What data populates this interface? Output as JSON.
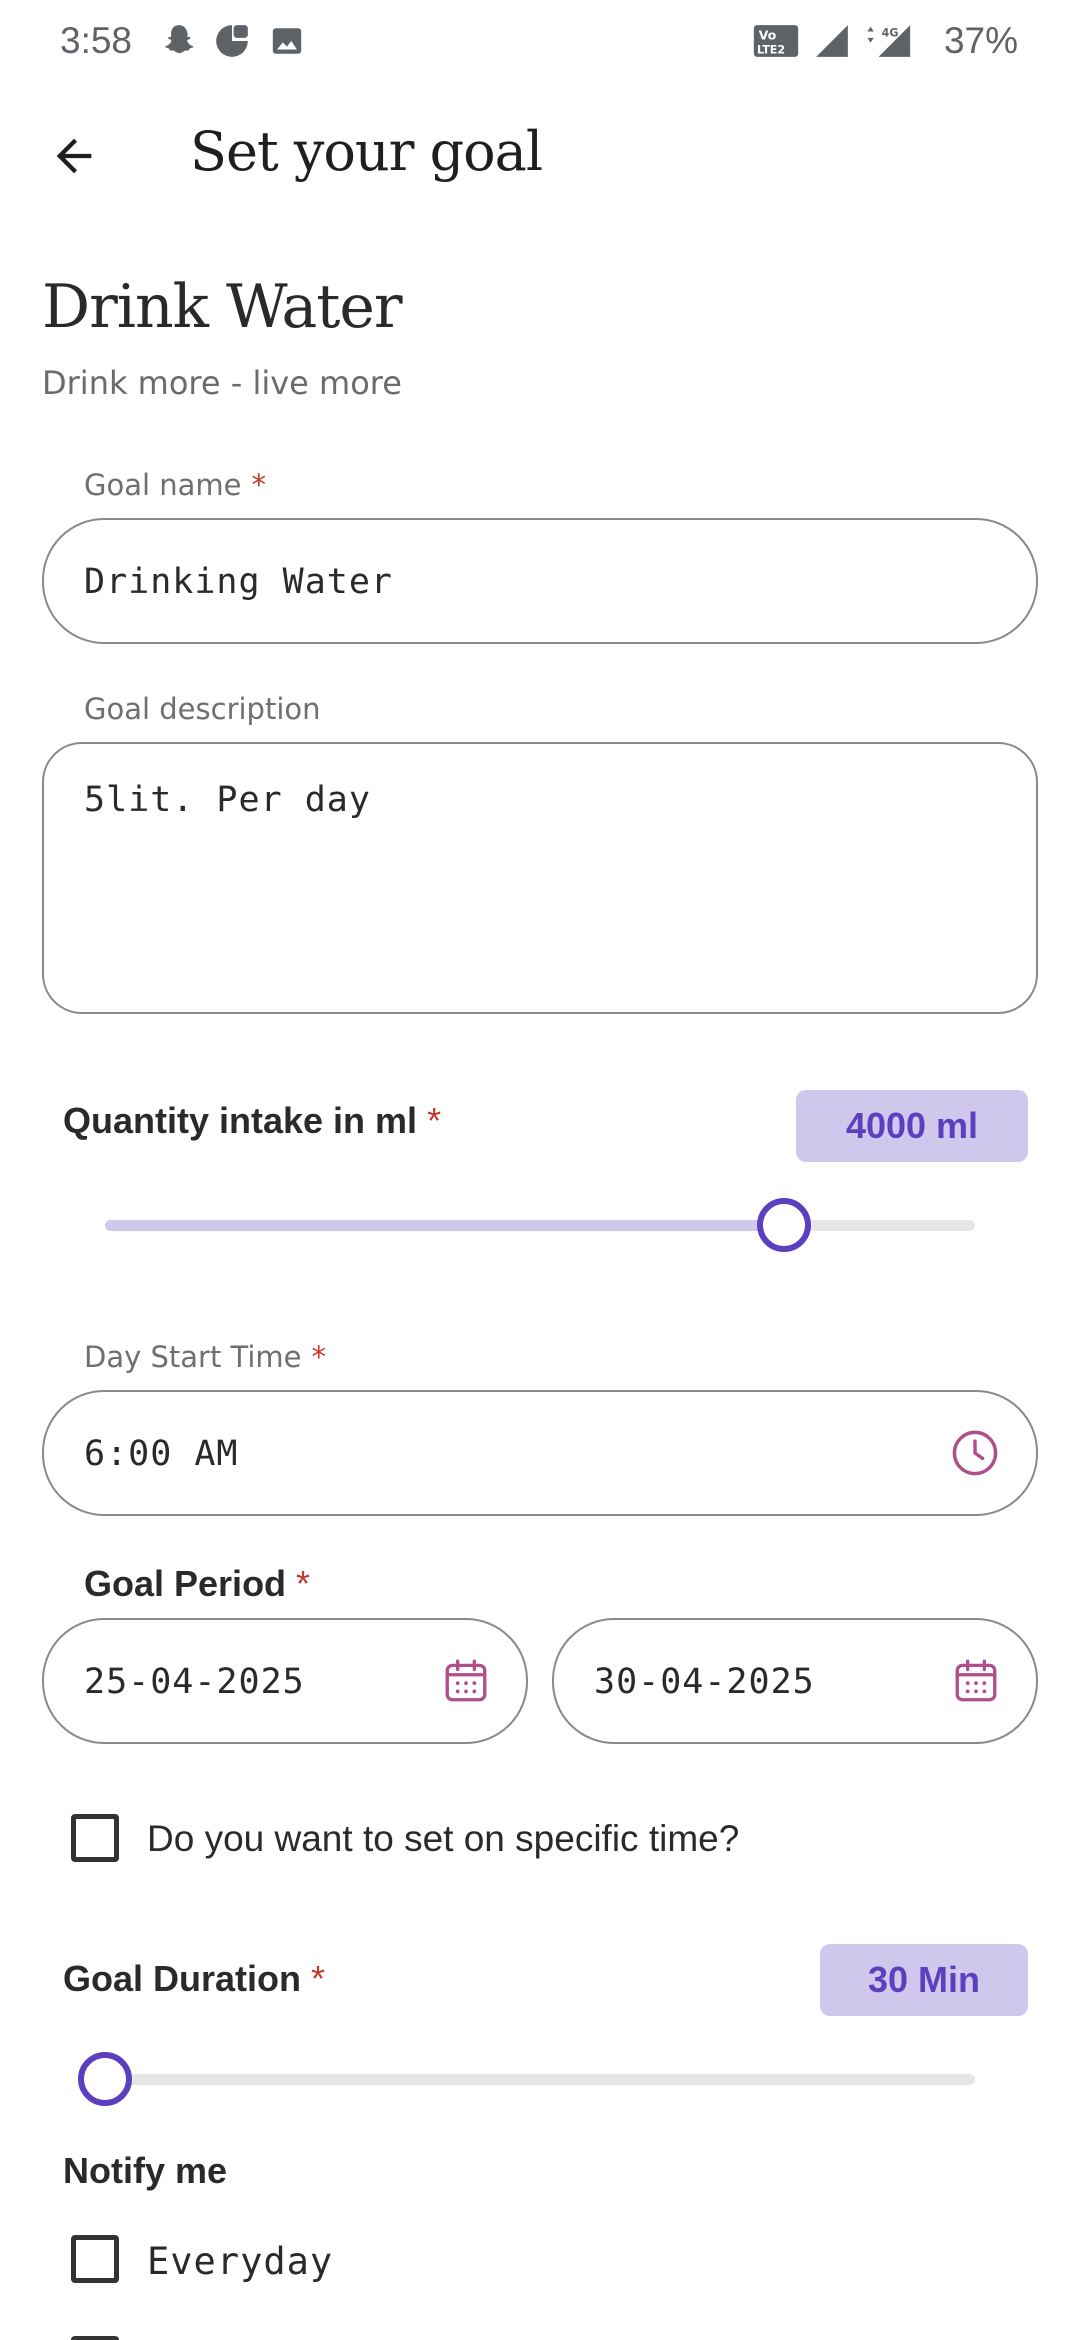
{
  "status_bar": {
    "time": "3:58",
    "battery": "37%",
    "icons": [
      "snapchat-icon",
      "g-app-icon",
      "image-icon",
      "volte-icon",
      "signal-icon",
      "4g-signal-icon"
    ]
  },
  "app_bar": {
    "back_icon": "arrow-back-icon",
    "title": "Set your goal"
  },
  "header": {
    "title": "Drink Water",
    "subtitle": "Drink more - live more"
  },
  "form": {
    "goal_name": {
      "label": "Goal name",
      "required_mark": "*",
      "value": "Drinking Water"
    },
    "goal_description": {
      "label": "Goal description",
      "value": "5lit. Per day"
    },
    "quantity": {
      "label": "Quantity intake in ml",
      "required_mark": "*",
      "value_text": "4000 ml",
      "slider_fraction": 0.78
    },
    "day_start": {
      "label": "Day Start Time",
      "required_mark": "*",
      "value": "6:00 AM",
      "icon": "clock-icon"
    },
    "goal_period": {
      "label": "Goal Period",
      "required_mark": "*",
      "start": "25-04-2025",
      "end": "30-04-2025",
      "icon": "calendar-icon"
    },
    "specific_time": {
      "label": "Do you want to set on specific time?",
      "checked": false
    },
    "duration": {
      "label": "Goal Duration",
      "required_mark": "*",
      "value_text": "30 Min",
      "slider_fraction": 0.0
    },
    "notify": {
      "label": "Notify me",
      "options": [
        {
          "label": "Everyday",
          "checked": false
        }
      ]
    }
  },
  "colors": {
    "accent": "#5b3fbf",
    "accent_light": "#cfc8ec",
    "required": "#c0392b",
    "icon_pink": "#b0508a"
  }
}
